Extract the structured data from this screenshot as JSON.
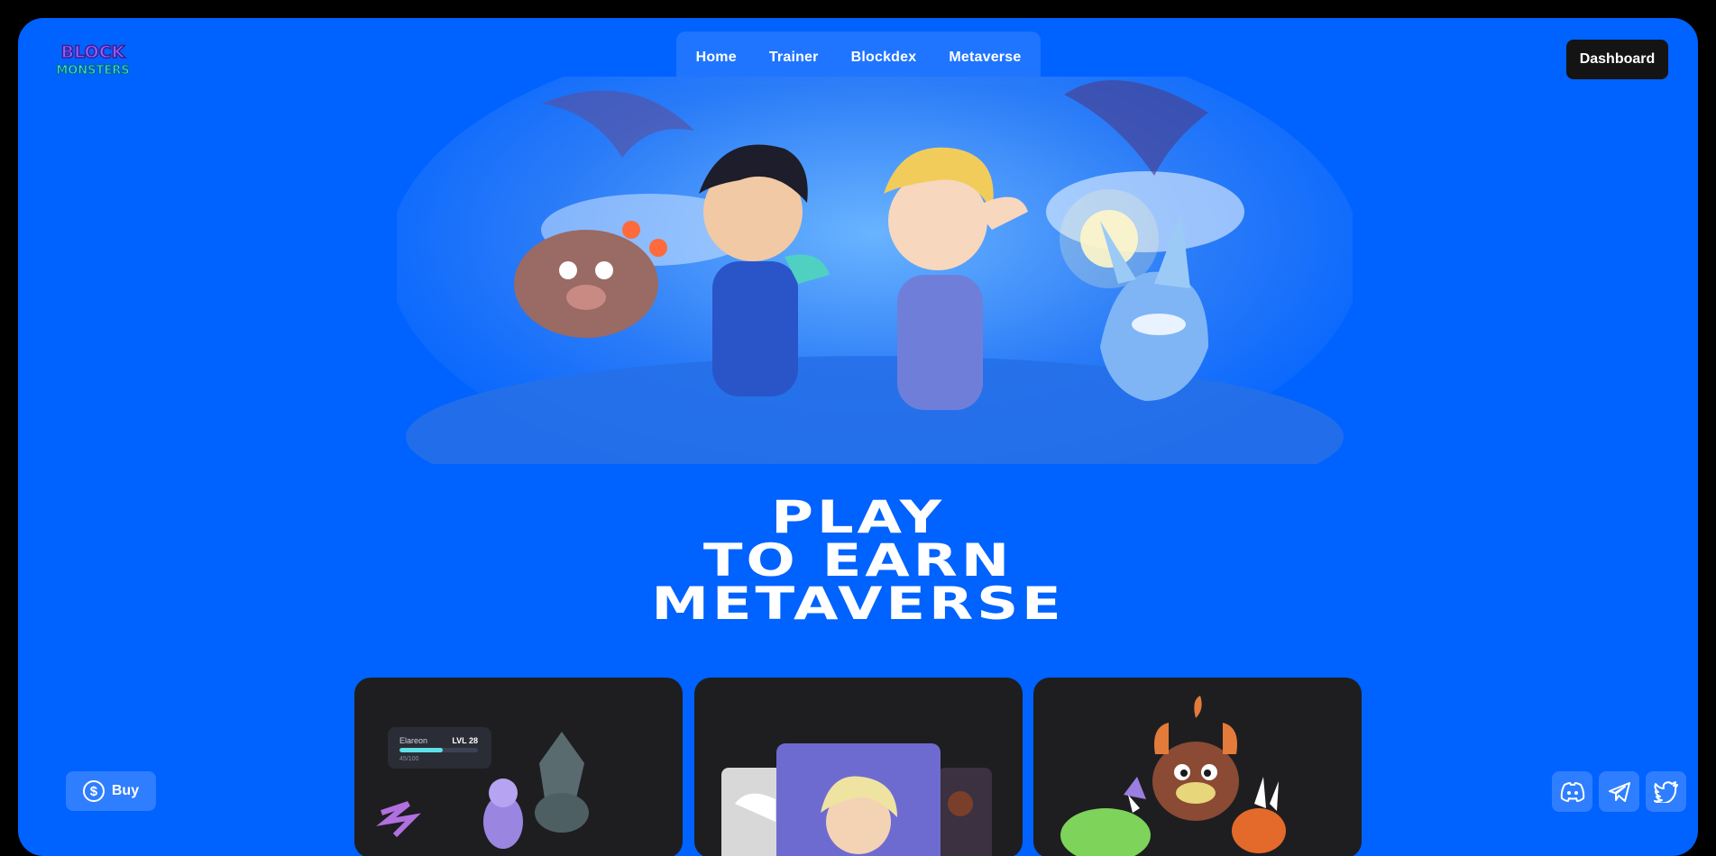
{
  "header": {
    "logo_lines": [
      "BLOCK",
      "MONSTERS"
    ],
    "nav": [
      "Home",
      "Trainer",
      "Blockdex",
      "Metaverse"
    ],
    "dashboard_label": "Dashboard"
  },
  "headline": {
    "lines": [
      "PLAY",
      "TO EARN",
      "METAVERSE"
    ]
  },
  "cards": {
    "card1": {
      "monster_name": "Elareon",
      "level": "LVL 28",
      "hp_text": "45/100",
      "progress": 0.55
    }
  },
  "buy_label": "Buy",
  "icons": [
    "dollar-coin-icon",
    "discord-icon",
    "telegram-icon",
    "twitter-icon"
  ],
  "colors": {
    "background": "#0062ff",
    "card": "#1e1e20",
    "dashboard_button": "#141414",
    "progress_fill": "#5fe1e8"
  }
}
